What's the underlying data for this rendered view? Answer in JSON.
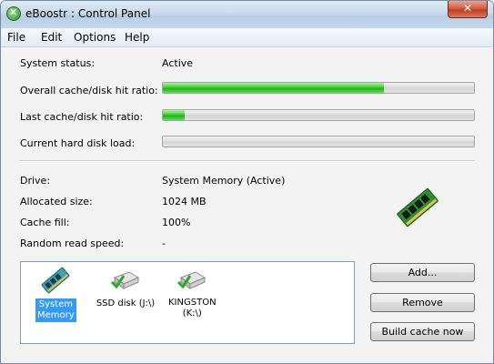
{
  "window": {
    "title": "eBoostr : Control Panel",
    "close_label": "✕"
  },
  "menu": [
    "File",
    "Edit",
    "Options",
    "Help"
  ],
  "status": {
    "system_status_label": "System status:",
    "system_status_value": "Active",
    "overall_hit_label": "Overall cache/disk hit ratio:",
    "overall_hit_fraction": 0.71,
    "last_hit_label": "Last cache/disk hit ratio:",
    "last_hit_fraction": 0.07,
    "disk_load_label": "Current hard disk load:",
    "disk_load_fraction": 0.0
  },
  "drive_info": {
    "drive_label": "Drive:",
    "drive_value": "System Memory (Active)",
    "allocated_label": "Allocated size:",
    "allocated_value": "1024 MB",
    "fill_label": "Cache fill:",
    "fill_value": "100%",
    "speed_label": "Random read speed:",
    "speed_value": "-"
  },
  "drives": [
    {
      "line1": "System",
      "line2": "Memory",
      "icon": "memory-stick-icon",
      "selected": true
    },
    {
      "line1": "SSD disk (J:\\)",
      "line2": "",
      "icon": "drive-check-icon",
      "selected": false
    },
    {
      "line1": "KINGSTON",
      "line2": "(K:\\)",
      "icon": "drive-check-icon",
      "selected": false
    }
  ],
  "buttons": {
    "add": "Add...",
    "remove": "Remove",
    "build": "Build cache now"
  },
  "colors": {
    "selection": "#3399ff",
    "bar_green": "#1fb21a",
    "title_gradient": "#c9dbec"
  }
}
